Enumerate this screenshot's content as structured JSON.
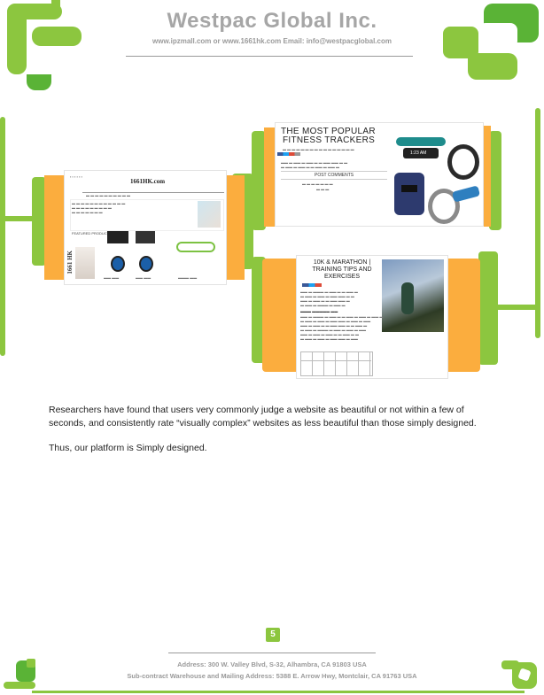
{
  "header": {
    "company": "Westpac Global Inc.",
    "contact": "www.ipzmall.com or www.1661hk.com  Email: info@westpacglobal.com"
  },
  "screenshot_site": {
    "logo": "1661HK.com",
    "side_logo": "1661 HK",
    "featured": "FEATURED PRODUCTS"
  },
  "screenshot_fitness": {
    "title_line1": "THE MOST POPULAR",
    "title_line2": "FITNESS TRACKERS",
    "post_comments": "POST COMMENTS"
  },
  "screenshot_marathon": {
    "title_line1": "10K & MARATHON |",
    "title_line2": "TRAINING TIPS AND",
    "title_line3": "EXERCISES"
  },
  "body": {
    "paragraph1": "Researchers have found that users very commonly judge a website as beautiful or not within a few of seconds, and consistently rate “visually complex” websites as less beautiful than those simply designed.",
    "paragraph2": "Thus, our platform is Simply designed."
  },
  "page_number": "5",
  "footer": {
    "address1": "Address: 300 W. Valley Blvd, S-32, Alhambra, CA 91803 USA",
    "address2": "Sub-contract Warehouse and Mailing Address: 5388 E. Arrow Hwy, Montclair, CA 91763 USA"
  },
  "colors": {
    "green": "#8cc63f",
    "dark_green": "#5ab336",
    "orange": "#fbad3e",
    "gray": "#9a9a9a"
  }
}
